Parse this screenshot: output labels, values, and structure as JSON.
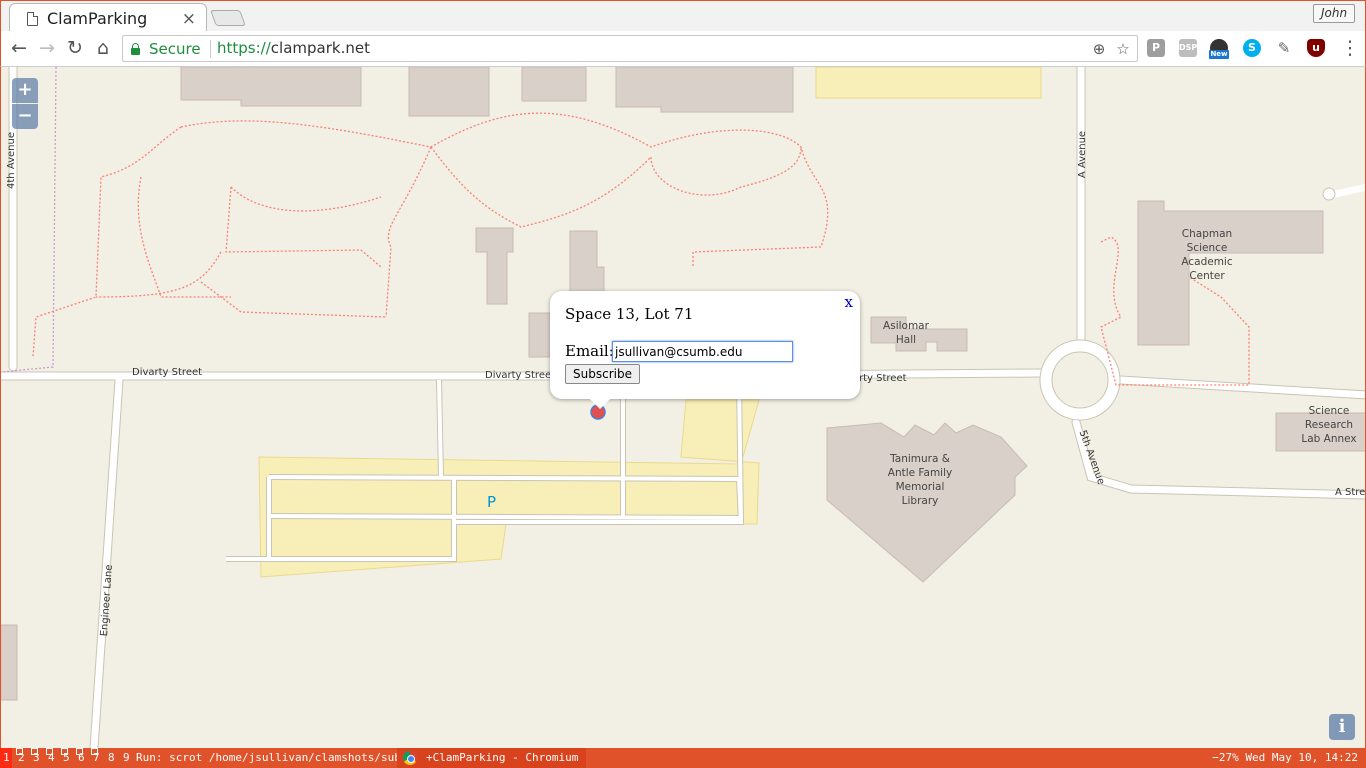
{
  "browser": {
    "tab_title": "ClamParking",
    "tab_close": "×",
    "profile_name": "John",
    "secure_label": "Secure",
    "url_scheme": "https://",
    "url_host": "clampark.net",
    "extensions": [
      {
        "name": "P",
        "color": "#9e9e9e"
      },
      {
        "name": "DSP",
        "color": "#bdbdbd"
      },
      {
        "name": "New",
        "color": "#1976d2"
      },
      {
        "name": "S",
        "color": "#00aff0"
      },
      {
        "name": "eyedropper",
        "color": "#666666"
      },
      {
        "name": "uO",
        "color": "#800000"
      }
    ]
  },
  "map": {
    "zoom_in": "+",
    "zoom_out": "−",
    "info": "i",
    "streets": {
      "fourth_avenue": "4th Avenue",
      "divarty_west": "Divarty Street",
      "divarty_mid": "Divarty Street",
      "divarty_east": "rty Street",
      "a_avenue": "A Avenue",
      "fifth_avenue": "5th Avenue",
      "a_street": "A Stre",
      "engineer_lane": "Engineer Lane"
    },
    "buildings": {
      "chapman": "Chapman Science Academic Center",
      "asilomar": "Asilomar Hall",
      "tanimura": "Tanimura & Antle Family Memorial Library",
      "science_research": "Science Research Lab Annex"
    },
    "parking_symbol": "P",
    "colors": {
      "background": "#f2efe4",
      "building": "#d9d0c9",
      "parking": "#f7efb7",
      "road": "#ffffff",
      "path": "#fa8072",
      "marker": "#e05050"
    }
  },
  "popup": {
    "title": "Space 13, Lot 71",
    "close": "x",
    "email_label": "Email:",
    "email_value": "jsullivan@csumb.edu",
    "subscribe_label": "Subscribe"
  },
  "taskbar": {
    "workspaces": [
      "1",
      "2",
      "3",
      "4",
      "5",
      "6",
      "7",
      "8",
      "9"
    ],
    "run_text": "Run: scrot /home/jsullivan/clamshots/sub.png",
    "task_label": "+ClamParking - Chromium",
    "tray_text": "−27%  Wed May 10, 14:22"
  }
}
